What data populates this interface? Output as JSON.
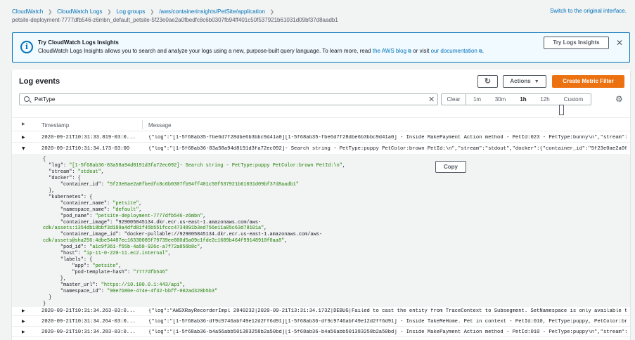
{
  "breadcrumb": {
    "items": [
      "CloudWatch",
      "CloudWatch Logs",
      "Log groups",
      "/aws/containerinsights/PetSite/application"
    ],
    "stream": "petsite-deployment-7777dfb546-z6mbn_default_petsite-5f23e0ae2a0fbedfc8c6b0307fb94ff401c50f537921b61031d09bf37d8aadb1"
  },
  "switch_link": "Switch to the original interface.",
  "info": {
    "title": "Try CloudWatch Logs Insights",
    "body_prefix": "CloudWatch Logs Insights allows you to search and analyze your logs using a new, purpose-built query language. To learn more, read ",
    "link1": "the AWS blog",
    "middle": " or visit ",
    "link2": "our documentation",
    "suffix": ".",
    "button": "Try Logs Insights"
  },
  "log_events": {
    "title": "Log events",
    "actions_label": "Actions",
    "create_label": "Create Metric Filter",
    "search_value": "PetType",
    "range": [
      "Clear",
      "1m",
      "30m",
      "1h",
      "12h",
      "Custom"
    ],
    "selected_range": "1h",
    "columns": {
      "timestamp": "Timestamp",
      "message": "Message"
    },
    "rows": [
      {
        "ts": "2020-09-21T10:31:33.819-03:0...",
        "msg": "{\"log\":\"[1-5f68ab35-fbe6d7f28dbe6b3bbc9d41a0][1-5f68ab35-fbe6d7f28dbe6b3bbc9d41a0] - Inside MakePayment Action method - PetId:023 - PetType:bunny\\n\",\"stream\":..."
      },
      {
        "ts": "2020-09-21T10:31:34.173-03:00",
        "msg": "{\"log\":\"[1-5f68ab36-83a58a94d8191d3fa72ec092]- Search string - PetType:puppy PetColor:brown PetId:\\n\",\"stream\":\"stdout\",\"docker\":{\"container_id\":\"5f23e0ae2a0f..."
      },
      {
        "ts": "2020-09-21T10:31:34.263-03:0...",
        "msg": "{\"log\":\"AWSXRayRecorderImpl 2840232|2020-09-21T13:31:34.173Z|DEBUG|Failed to cast the entity from TraceContext to Subsegment. SetNamespace is only available t..."
      },
      {
        "ts": "2020-09-21T10:31:34.264-03:0...",
        "msg": "{\"log\":\"[1-5f68ab36-df9c9746abf49e12d2ff6d91][1-5f68ab36-df9c9746abf49e12d2ff6d91] - Inside TakeMeHome. Pet in context - PetId:010, PetType:puppy, PetColor:br..."
      },
      {
        "ts": "2020-09-21T10:31:34.283-03:0...",
        "msg": "{\"log\":\"[1-5f68ab36-b4a56abb501383258b2a50bd][1-5f68ab36-b4a56abb501383258b2a50bd] - Inside MakePayment Action method - PetId:010 - PetType:puppy\\n\",\"stream\":..."
      }
    ],
    "copy_label": "Copy",
    "json_lines": [
      "{",
      "  \"log\": \"[1-5f68ab36-83a58a94d8191d3fa72ec092]- Search string - PetType:puppy PetColor:brown PetId:\\n\",",
      "  \"stream\": \"stdout\",",
      "  \"docker\": {",
      "      \"container_id\": \"5f23e0ae2a0fbedfc8c6b0307fb94ff401c50f537921b61031d09bf37d8aadb1\"",
      "  },",
      "  \"kubernetes\": {",
      "      \"container_name\": \"petsite\",",
      "      \"namespace_name\": \"default\",",
      "      \"pod_name\": \"petsite-deployment-7777dfb546-z6mbn\",",
      "      \"container_image\": \"929005845134.dkr.ecr.us-east-1.amazonaws.com/aws-",
      "cdk/assets:1354db18bbf3d189a4dfd81f45b551fccc4734891b3ed756e11a05c63d78101a\",",
      "      \"container_image_id\": \"docker-pullable://929005845134.dkr.ecr.us-east-1.amazonaws.com/aws-",
      "cdk/assets@sha256:4dbe54487ec16330085f79739ee800d5a09c1fde2c1609b464f99148910f0aa8\",",
      "      \"pod_id\": \"a1c9f361-f55b-4a58-926c-a7f72a856b8c\",",
      "      \"host\": \"ip-11-0-220-11.ec2.internal\",",
      "      \"labels\": {",
      "          \"app\": \"petsite\",",
      "          \"pod-template-hash\": \"7777dfb546\"",
      "      },",
      "      \"master_url\": \"https://10.100.0.1:443/api\",",
      "      \"namespace_id\": \"90e7b80e-474e-4f32-bbff-002ad320b5b3\"",
      "  }",
      "}"
    ]
  }
}
